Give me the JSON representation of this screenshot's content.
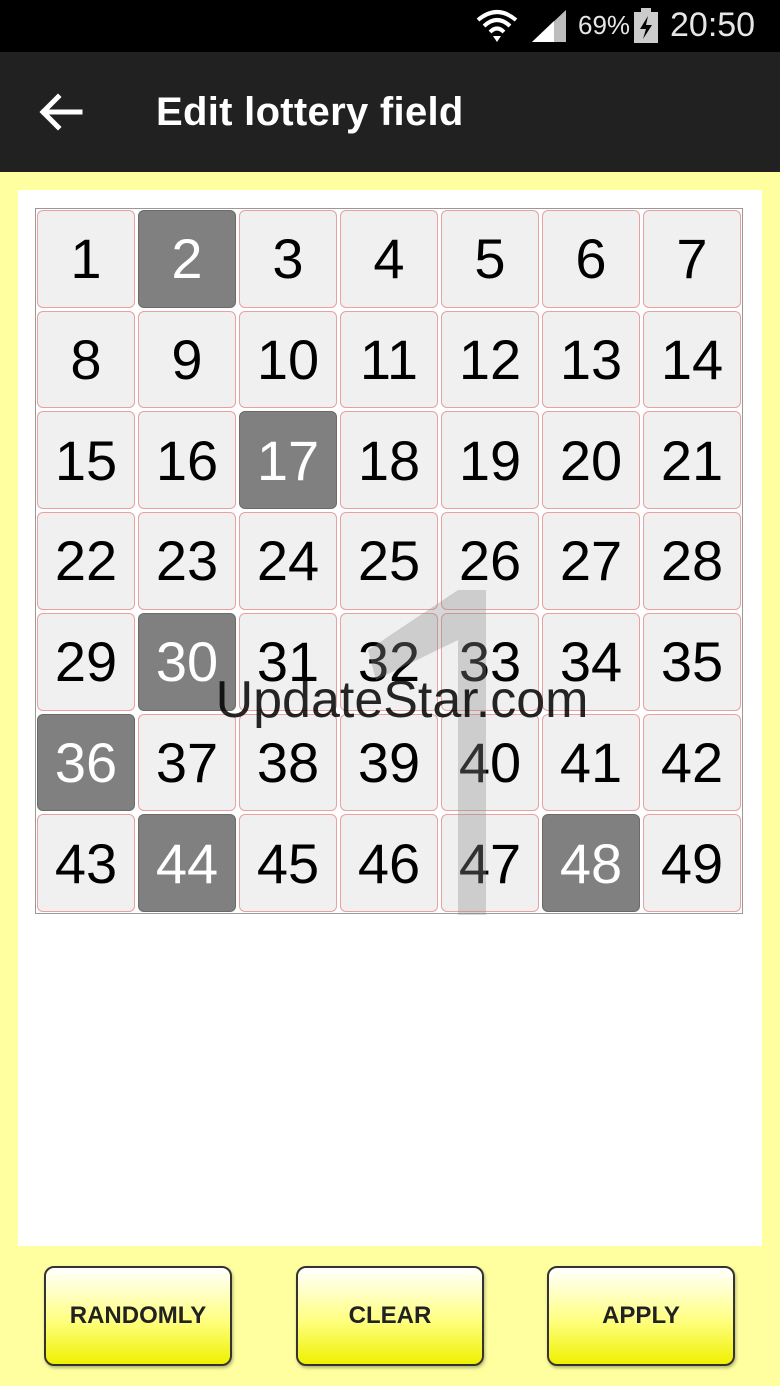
{
  "status_bar": {
    "battery_percent": "69%",
    "time": "20:50"
  },
  "app_bar": {
    "title": "Edit lottery field",
    "back_icon": "arrow-left-icon"
  },
  "lottery_grid": {
    "numbers": [
      "1",
      "2",
      "3",
      "4",
      "5",
      "6",
      "7",
      "8",
      "9",
      "10",
      "11",
      "12",
      "13",
      "14",
      "15",
      "16",
      "17",
      "18",
      "19",
      "20",
      "21",
      "22",
      "23",
      "24",
      "25",
      "26",
      "27",
      "28",
      "29",
      "30",
      "31",
      "32",
      "33",
      "34",
      "35",
      "36",
      "37",
      "38",
      "39",
      "40",
      "41",
      "42",
      "43",
      "44",
      "45",
      "46",
      "47",
      "48",
      "49"
    ],
    "selected": [
      2,
      17,
      30,
      36,
      44,
      48
    ]
  },
  "watermark": {
    "text": "UpdateStar.com"
  },
  "buttons": {
    "randomly": "RANDOMLY",
    "clear": "CLEAR",
    "apply": "APPLY"
  },
  "colors": {
    "selected_cell": "#808080",
    "cell": "#f0f0f0",
    "button_yellow": "#ffff80",
    "background": "#ffffa0"
  }
}
